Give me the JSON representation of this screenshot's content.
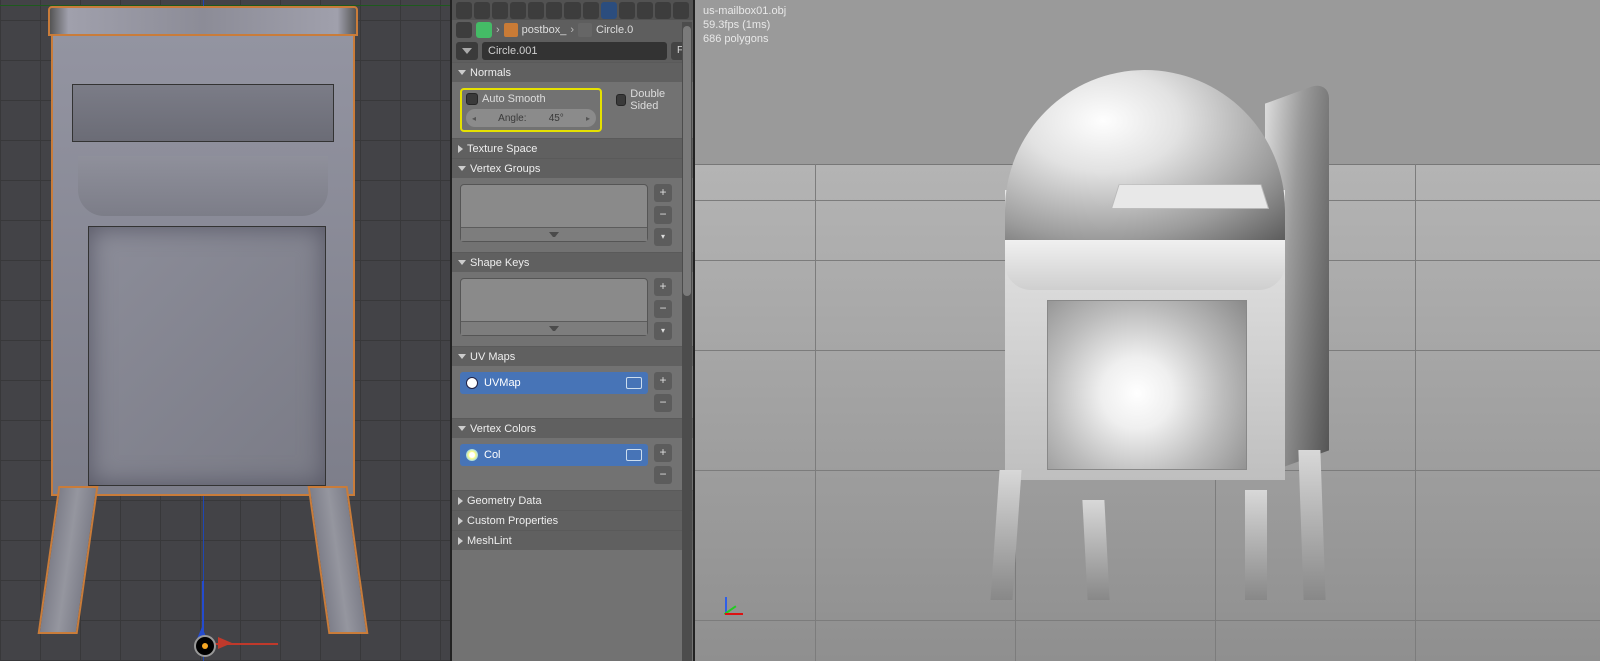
{
  "breadcrumb": {
    "scene": "postbox_",
    "object": "Circle.0"
  },
  "datablock": {
    "name": "Circle.001",
    "fake_user": "F"
  },
  "sections": {
    "normals": {
      "title": "Normals",
      "auto_smooth_label": "Auto Smooth",
      "angle_label": "Angle:",
      "angle_value": "45°",
      "double_sided_label": "Double Sided"
    },
    "texture_space": {
      "title": "Texture Space"
    },
    "vertex_groups": {
      "title": "Vertex Groups"
    },
    "shape_keys": {
      "title": "Shape Keys"
    },
    "uv_maps": {
      "title": "UV Maps",
      "active": "UVMap"
    },
    "vertex_colors": {
      "title": "Vertex Colors",
      "active": "Col"
    },
    "geometry_data": {
      "title": "Geometry Data"
    },
    "custom_properties": {
      "title": "Custom Properties"
    },
    "meshlint": {
      "title": "MeshLint"
    }
  },
  "viewer": {
    "filename": "us-mailbox01.obj",
    "fps": "59.3fps (1ms)",
    "polys": "686 polygons"
  }
}
